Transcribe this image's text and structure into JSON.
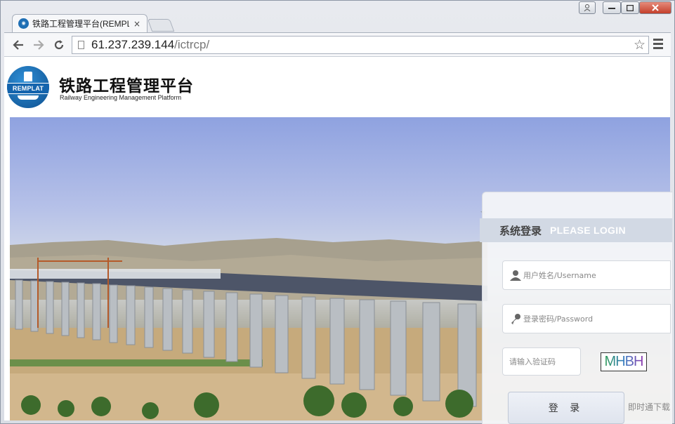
{
  "browser": {
    "tab_title": "铁路工程管理平台(REMPLAT)",
    "tab_close": "×",
    "url_host": "61.237.239.144",
    "url_path": "/ictrcp/",
    "icons": {
      "back": "back-arrow-icon",
      "forward": "forward-arrow-icon",
      "reload": "reload-icon",
      "star": "star-icon",
      "menu": "hamburger-menu-icon"
    }
  },
  "window_buttons": {
    "user": "user-icon",
    "minimize": "minimize-icon",
    "maximize": "maximize-icon",
    "close": "close-icon"
  },
  "header": {
    "logo_text": "REMPLAT",
    "title": "铁路工程管理平台",
    "subtitle": "Railway Engineering Management Platform"
  },
  "login": {
    "title_cn": "系统登录",
    "title_en": "PLEASE LOGIN",
    "username_placeholder": "用户姓名/Username",
    "password_placeholder": "登录密码/Password",
    "captcha_placeholder": "请输入验证码",
    "captcha_text": "MHBH",
    "button_label": "登 录",
    "download_link": "即时通下载"
  },
  "colors": {
    "brand_blue": "#1464ad",
    "login_header": "#d2d9e4",
    "sky": "#8fa2e0"
  }
}
